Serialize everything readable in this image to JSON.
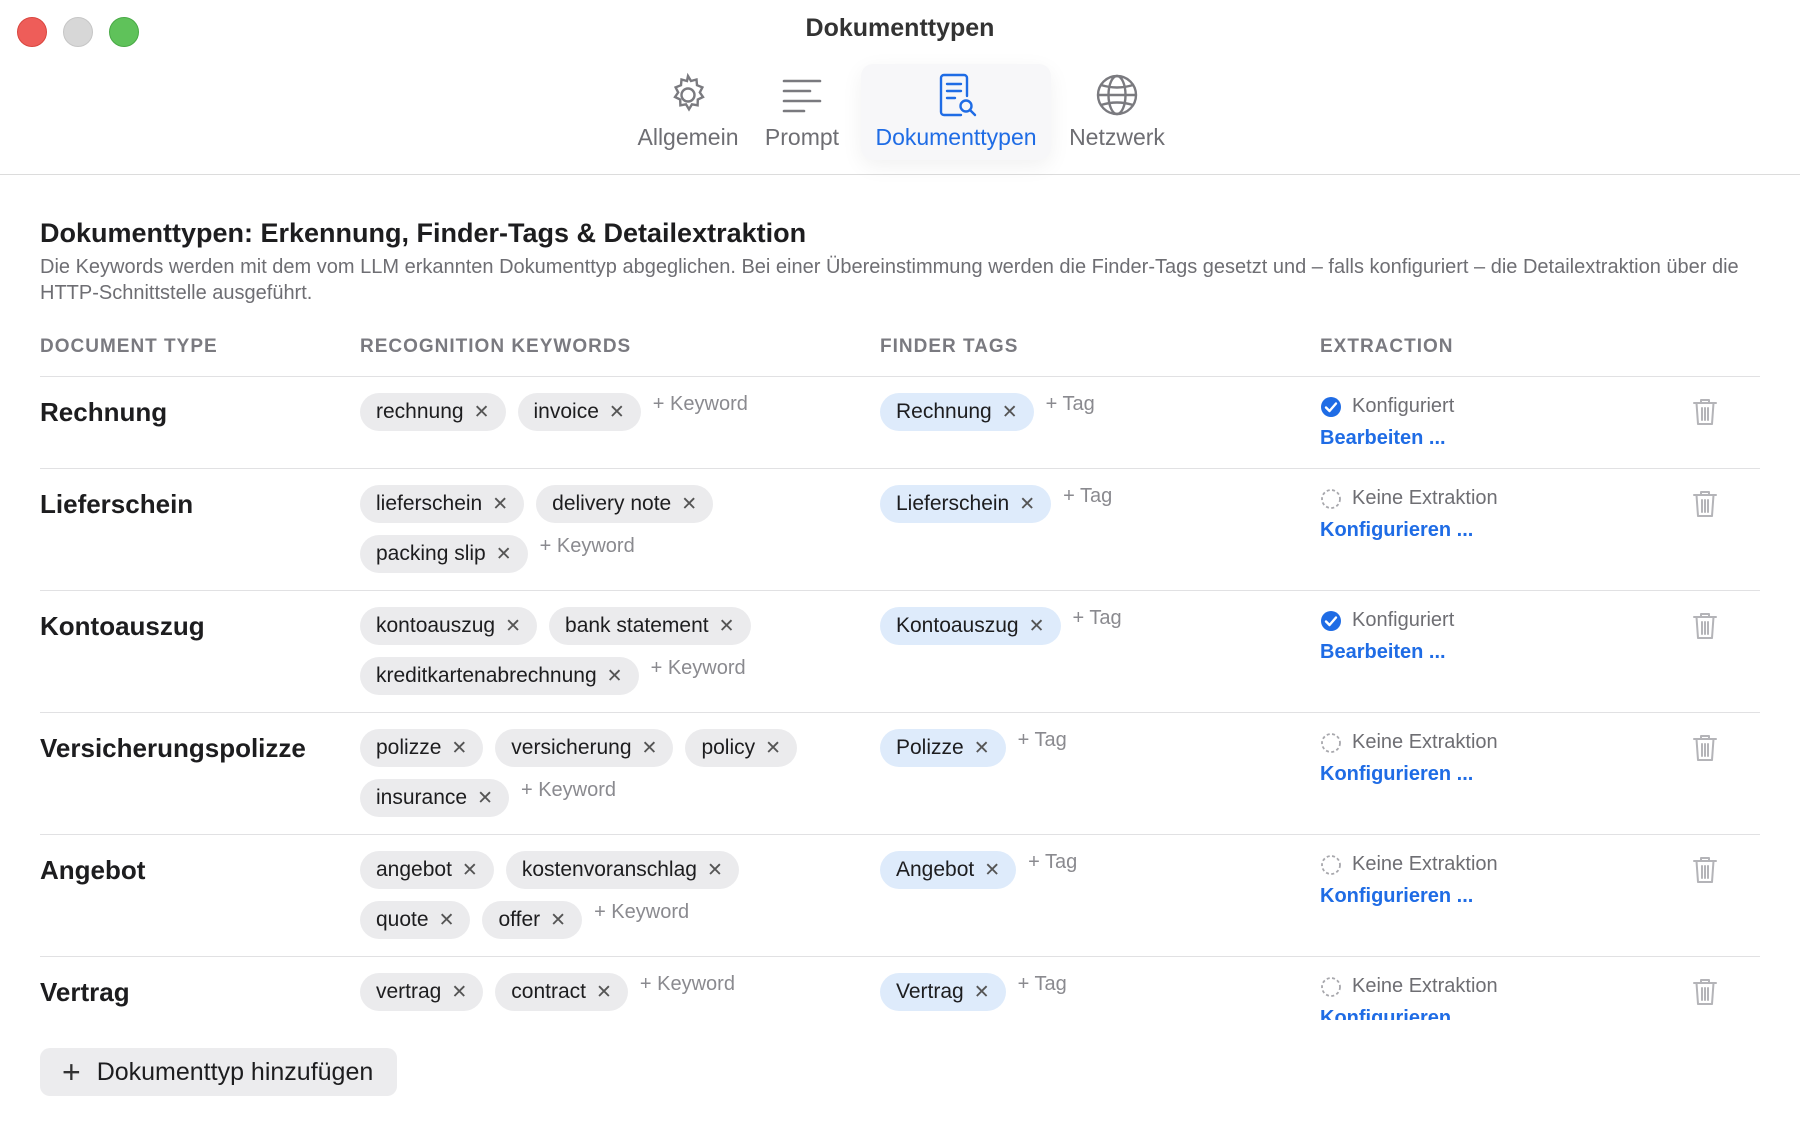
{
  "window": {
    "title": "Dokumenttypen"
  },
  "tabs": [
    {
      "label": "Allgemein",
      "icon": "gear-icon"
    },
    {
      "label": "Prompt",
      "icon": "text-lines-icon"
    },
    {
      "label": "Dokumenttypen",
      "icon": "document-search-icon",
      "active": true
    },
    {
      "label": "Netzwerk",
      "icon": "globe-icon"
    }
  ],
  "section": {
    "title": "Dokumenttypen: Erkennung, Finder-Tags & Detailextraktion",
    "description": "Die Keywords werden mit dem vom LLM erkannten Dokumenttyp abgeglichen. Bei einer Übereinstimmung werden die Finder-Tags gesetzt und – falls konfiguriert – die Detailextraktion über die HTTP-Schnittstelle ausgeführt."
  },
  "columns": {
    "document_type": "DOCUMENT TYPE",
    "keywords": "RECOGNITION KEYWORDS",
    "tags": "FINDER TAGS",
    "extraction": "EXTRACTION"
  },
  "labels": {
    "add_keyword": "+ Keyword",
    "add_tag": "+ Tag",
    "remove": "✕",
    "add_type_button": "Dokumenttyp hinzufügen"
  },
  "colors": {
    "accent": "#1f6ce5",
    "tag_chip": "#deebfb",
    "keyword_chip": "#ebebed"
  },
  "doc_types": [
    {
      "name": "Rechnung",
      "keywords": [
        "rechnung",
        "invoice"
      ],
      "tags": [
        "Rechnung"
      ],
      "configured": true,
      "status": "Konfiguriert",
      "action": "Bearbeiten ..."
    },
    {
      "name": "Lieferschein",
      "keywords": [
        "lieferschein",
        "delivery note",
        "packing slip"
      ],
      "tags": [
        "Lieferschein"
      ],
      "configured": false,
      "status": "Keine Extraktion",
      "action": "Konfigurieren ..."
    },
    {
      "name": "Kontoauszug",
      "keywords": [
        "kontoauszug",
        "bank statement",
        "kreditkartenabrechnung"
      ],
      "tags": [
        "Kontoauszug"
      ],
      "configured": true,
      "status": "Konfiguriert",
      "action": "Bearbeiten ..."
    },
    {
      "name": "Versicherungspolizze",
      "keywords": [
        "polizze",
        "versicherung",
        "policy",
        "insurance"
      ],
      "tags": [
        "Polizze"
      ],
      "configured": false,
      "status": "Keine Extraktion",
      "action": "Konfigurieren ..."
    },
    {
      "name": "Angebot",
      "keywords": [
        "angebot",
        "kostenvoranschlag",
        "quote",
        "offer"
      ],
      "tags": [
        "Angebot"
      ],
      "configured": false,
      "status": "Keine Extraktion",
      "action": "Konfigurieren ..."
    },
    {
      "name": "Vertrag",
      "keywords": [
        "vertrag",
        "contract"
      ],
      "tags": [
        "Vertrag"
      ],
      "configured": false,
      "status": "Keine Extraktion",
      "action": "Konfigurieren ..."
    }
  ]
}
